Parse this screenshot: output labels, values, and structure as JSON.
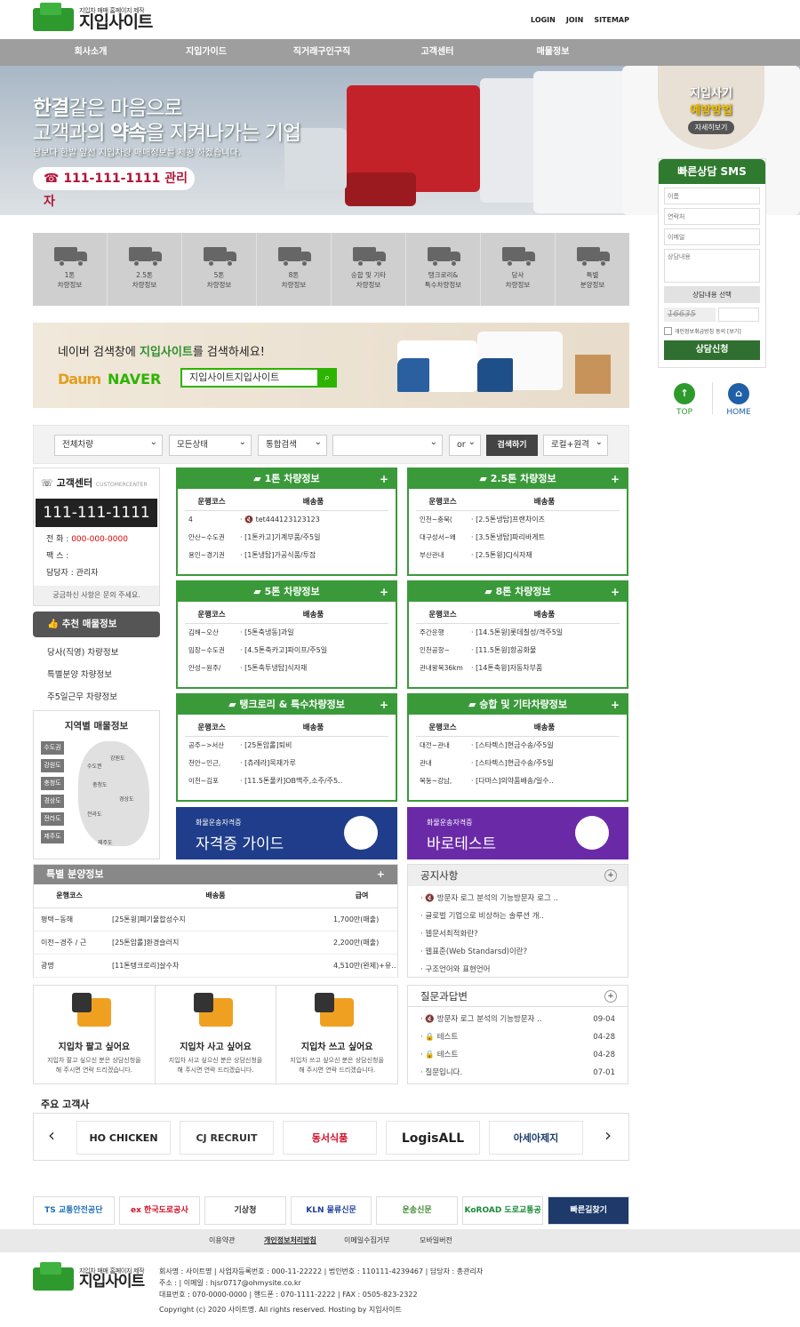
{
  "header": {
    "logo_sub": "지입차 매매 홈페이지 제작",
    "logo_main": "지입사이트",
    "links": [
      "LOGIN",
      "JOIN",
      "SITEMAP"
    ]
  },
  "nav": [
    "회사소개",
    "지입가이드",
    "직거래구인구직",
    "고객센터",
    "매물정보"
  ],
  "hero": {
    "line1_bold": "한결",
    "line1_rest": "같은 마음으로",
    "line2_a": "고객과의 ",
    "line2_bold": "약속",
    "line2_b": "을 지켜나가는 기업",
    "line3": "남보다 한발 앞선 지입차량 매매정보를 제공 하겠습니다.",
    "phone": "☎ 111-111-1111 관리자"
  },
  "badge": {
    "t1": "지입사기",
    "t2": "예방방법",
    "t3": "자세히보기"
  },
  "sms": {
    "title": "빠른상담 SMS",
    "name_ph": "이름",
    "contact_ph": "연락처",
    "email_ph": "이메일",
    "content_ph": "상담내용",
    "select": "상담내용 선택",
    "captcha": "16635",
    "agree": "개인정보취급방침 동의 [보기]",
    "submit": "상담신청"
  },
  "quick": {
    "top": "TOP",
    "home": "HOME"
  },
  "categories": [
    {
      "l1": "1톤",
      "l2": "차량정보"
    },
    {
      "l1": "2.5톤",
      "l2": "차량정보"
    },
    {
      "l1": "5톤",
      "l2": "차량정보"
    },
    {
      "l1": "8톤",
      "l2": "차량정보"
    },
    {
      "l1": "승합 및 기타",
      "l2": "차량정보"
    },
    {
      "l1": "탱크로리&",
      "l2": "특수차량정보"
    },
    {
      "l1": "당사",
      "l2": "차량정보"
    },
    {
      "l1": "특별",
      "l2": "분양정보"
    }
  ],
  "naver": {
    "q_a": "네이버 검색창에 ",
    "q_bold": "지입사이트",
    "q_b": "를 검색하세요!",
    "daum": "Daum",
    "naver": "NAVER",
    "search": "지입사이트지입사이트",
    "btn": "⌕"
  },
  "filters": {
    "s1": "전체차량",
    "s2": "모든상태",
    "s3": "통합검색",
    "s4": "or",
    "btn": "검색하기",
    "s5": "로컬+원격"
  },
  "cs": {
    "title": "고객센터",
    "title_en": "CUSTOMERCENTER",
    "number": "111-111-1111",
    "tel_label": "전   화 : ",
    "tel": "000-000-0000",
    "fax": "팩   스 : ",
    "mgr": "담당자 : 관리자",
    "foot": "궁금하신 사항은 문의 주세요."
  },
  "recommend": {
    "title": "추천 매물정보",
    "items": [
      "당사(직영) 차량정보",
      "특별분양 차량정보",
      "주5일근무 차량정보"
    ]
  },
  "region": {
    "title": "지역별 매물정보",
    "tags": [
      "수도권",
      "강원도",
      "충청도",
      "경상도",
      "전라도",
      "제주도"
    ],
    "labels": [
      "강원도",
      "수도권",
      "충청도",
      "경상도",
      "전라도",
      "제주도"
    ]
  },
  "boards": [
    {
      "title": "1톤 차량정보",
      "rows": [
        [
          "4",
          "· 🔇 tet444123123123"
        ],
        [
          "안산~수도권",
          "· [1톤카고]기계부품/주5일"
        ],
        [
          "용인~경기권",
          "· [1톤냉탑]가공식품/투잡"
        ]
      ]
    },
    {
      "title": "2.5톤 차량정보",
      "rows": [
        [
          "인천~충북(",
          "· [2.5톤냉탑]프랜차이즈"
        ],
        [
          "대구성서~왜",
          "· [3.5톤냉탑]파리바게트"
        ],
        [
          "부산관내",
          "· [2.5톤윙]CJ식자재"
        ]
      ]
    },
    {
      "title": "5톤 차량정보",
      "rows": [
        [
          "김해~오산",
          "· [5톤축냉동]과일"
        ],
        [
          "임장~수도권",
          "· [4.5톤축카고]파이프/주5일"
        ],
        [
          "안성~원주/",
          "· [5톤축투냉탑]식자재"
        ]
      ]
    },
    {
      "title": "8톤 차량정보",
      "rows": [
        [
          "주간운행",
          "· [14.5톤윙]롯데칠성/격주5일"
        ],
        [
          "인천공항~",
          "· [11.5톤윙]항공화물"
        ],
        [
          "관내왕복36km",
          "· [14톤축윙]자동차부품"
        ]
      ]
    },
    {
      "title": "탱크로리 & 특수차량정보",
      "rows": [
        [
          "공주~>서산",
          "· [25톤암롤]퇴비"
        ],
        [
          "천안~인근,",
          "· [츄레라]목재가루"
        ],
        [
          "이천~김포",
          "· [11.5톤풀카]OB맥주,소주/주5.."
        ]
      ]
    },
    {
      "title": "승합 및 기타차량정보",
      "rows": [
        [
          "대전~관내",
          "· [스타렉스]현금수송/주5일"
        ],
        [
          "관내",
          "· [스타렉스]현금수송/주5일"
        ],
        [
          "목동~강남,",
          "· [다마스]의약품배송/일수.."
        ]
      ]
    }
  ],
  "board_head": {
    "c1": "운행코스",
    "c2": "배송품"
  },
  "banners": [
    {
      "small": "화물운송자격증",
      "big": "자격증 가이드"
    },
    {
      "small": "화물운송자격증",
      "big": "바로테스트"
    }
  ],
  "special": {
    "title": "특별 분양정보",
    "heads": [
      "운행코스",
      "배송품",
      "급여"
    ],
    "rows": [
      [
        "평택~동해",
        "[25톤윙]폐기물합성수지",
        "1,700만(매출)"
      ],
      [
        "이천~경주 / 근",
        "[25톤암롤]환경슬러지",
        "2,200만(매출)"
      ],
      [
        "광명",
        "[11톤탱크로리]살수차",
        "4,510만(완제)+유.."
      ]
    ]
  },
  "notice": {
    "title": "공지사항",
    "items": [
      "· 🔇 방문자 로그 분석의 기능방문자 로그 ..",
      "· 글로벌 기업으로 비상하는 솔루션 개..",
      "· 웹문서최적화란?",
      "· 웹표준(Web Standarsd)이란?",
      "· 구조언어와 표현언어"
    ]
  },
  "qna": {
    "title": "질문과답변",
    "items": [
      [
        "· 🔇 방문자 로그 분석의 기능방문자 ..",
        "09-04"
      ],
      [
        "· 🔒 테스트",
        "04-28"
      ],
      [
        "· 🔒 테스트",
        "04-28"
      ],
      [
        "· 질문입니다.",
        "07-01"
      ]
    ]
  },
  "services": [
    {
      "title": "지입차 팔고 싶어요",
      "d1": "지입차 팔고 싶으신 분은 상담신청을",
      "d2": "해 주시면 연락 드리겠습니다."
    },
    {
      "title": "지입차 사고 싶어요",
      "d1": "지입차 사고 싶으신 분은 상담신청을",
      "d2": "해 주시면 연락 드리겠습니다."
    },
    {
      "title": "지입차 쓰고 싶어요",
      "d1": "지입차 쓰고 싶으신 분은 상담신청을",
      "d2": "해 주시면 연락 드리겠습니다."
    }
  ],
  "clients": {
    "title": "주요 고객사",
    "logos": [
      "HO CHICKEN",
      "CJ RECRUIT",
      "동서식품",
      "LogisALL",
      "아세아제지"
    ]
  },
  "partners": [
    "TS 교통안전공단",
    "ex 한국도로공사",
    "기상청",
    "KLN 물류신문",
    "운송신문",
    "KoROAD 도로교통공단",
    "빠른길찾기"
  ],
  "footer": {
    "links": [
      "이용약관",
      "개인정보처리방침",
      "이메일수집거부",
      "모바일버전"
    ],
    "logo_sub": "지입차 매매 홈페이지 제작",
    "logo_main": "지입사이트",
    "l1": "회사명 : 사이트명 | 사업자등록번호 : 000-11-22222 | 법인번호 : 110111-4239467 | 담당자 : 총관리자",
    "l2": "주소 : | 이메일 : hjsr0717@ohmysite.co.kr",
    "l3": "대표번호 : 070-0000-0000 | 핸드폰 : 070-1111-2222 | FAX : 0505-823-2322",
    "l4": "Copyright (c) 2020 사이트명. All rights reserved. Hosting by 지입사이트"
  }
}
